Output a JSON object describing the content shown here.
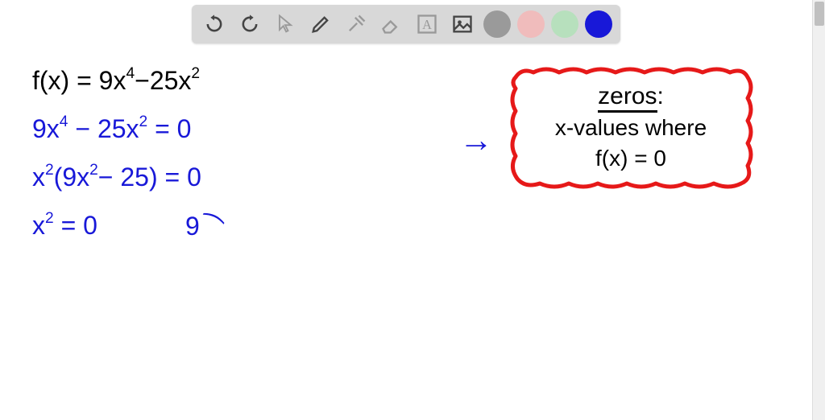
{
  "toolbar": {
    "icons": {
      "undo": "undo-icon",
      "redo": "redo-icon",
      "pointer": "pointer-icon",
      "pen": "pen-icon",
      "tools": "tools-icon",
      "eraser": "eraser-icon",
      "text": "text-icon",
      "image": "image-icon"
    },
    "colors": {
      "gray": "#9a9a9a",
      "pink": "#f0bcbc",
      "green": "#b7e0bd",
      "blue": "#1818d8"
    }
  },
  "math": {
    "line1_plain": "f(x) = 9x^4 - 25x^2",
    "line2_plain": "9x^4 - 25x^2 = 0",
    "line3_plain": "x^2(9x^2 - 25) = 0",
    "line4a_plain": "x^2 = 0",
    "line4b_plain": "9"
  },
  "note": {
    "title": "zeros",
    "colon": ":",
    "line1": "x-values where",
    "line2": "f(x) = 0"
  },
  "arrow": "→"
}
